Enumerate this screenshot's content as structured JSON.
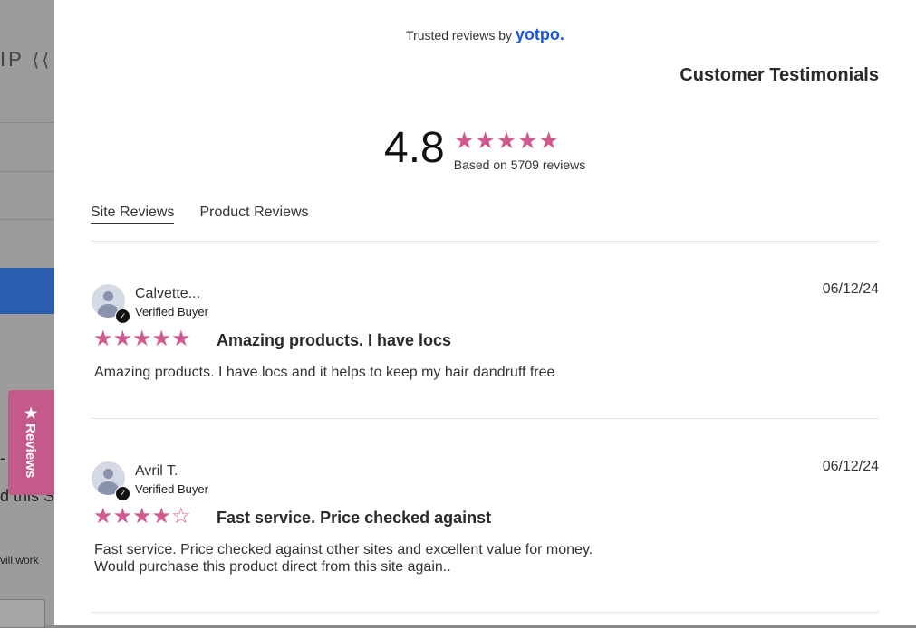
{
  "background": {
    "logo_text": "IP",
    "partial_text_1": "d this S",
    "partial_text_2": "vill work",
    "dash": "-"
  },
  "reviews_tab": {
    "label": "Reviews"
  },
  "header": {
    "trusted_text": "Trusted reviews by",
    "brand": "yotpo.",
    "title": "Customer Testimonials"
  },
  "summary": {
    "average": "4.8",
    "stars": 5,
    "based_on": "Based on 5709 reviews"
  },
  "tabs": [
    {
      "label": "Site Reviews",
      "active": true
    },
    {
      "label": "Product Reviews",
      "active": false
    }
  ],
  "reviews": [
    {
      "name": "Calvette...",
      "badge": "Verified Buyer",
      "date": "06/12/24",
      "rating": 5,
      "title": "Amazing products. I have locs",
      "body": "Amazing products. I have locs and it helps to keep my hair dandruff free"
    },
    {
      "name": "Avril T.",
      "badge": "Verified Buyer",
      "date": "06/12/24",
      "rating": 4,
      "title": "Fast service. Price checked against",
      "body": "Fast service. Price checked against other sites and excellent value for money. Would purchase this product direct from this site again.."
    }
  ],
  "colors": {
    "star": "#d0598f",
    "brand": "#1a55e3",
    "reviews_tab": "#c45a8c"
  }
}
